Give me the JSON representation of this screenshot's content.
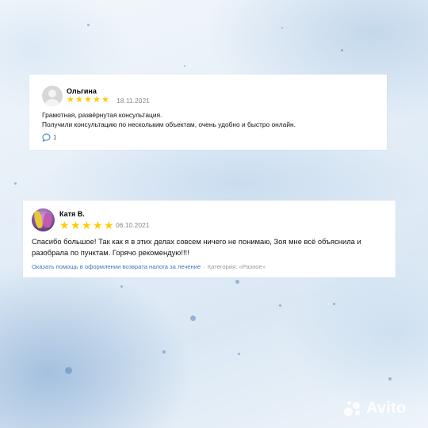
{
  "reviews": [
    {
      "author": "Ольгина",
      "rating": 5,
      "stars": [
        "★",
        "★",
        "★",
        "★",
        "★"
      ],
      "date": "18.11.2021",
      "text_lines": [
        "Грамотная, развёрнутая консультация.",
        "Получили консультацию по нескольким объектам, очень удобно и быстро онлайн."
      ],
      "comment_count": "1"
    },
    {
      "author": "Катя В.",
      "rating": 5,
      "stars": [
        "★",
        "★",
        "★",
        "★",
        "★"
      ],
      "date": "06.10.2021",
      "text_lines": [
        "Спасибо большое! Так как я в этих делах совсем ничего не понимаю, Зоя мне всё объяснила и",
        "разобрала по пунктам. Горячо рекомендую!!!!"
      ],
      "service_link": "Оказать помощь в оформлении возврата налога за лечение",
      "separator": "·",
      "category": "Категория: «Разное»"
    }
  ],
  "watermark": "Avito",
  "colors": {
    "star": "#ffcc00",
    "link": "#3a77c9",
    "muted": "#888888"
  }
}
